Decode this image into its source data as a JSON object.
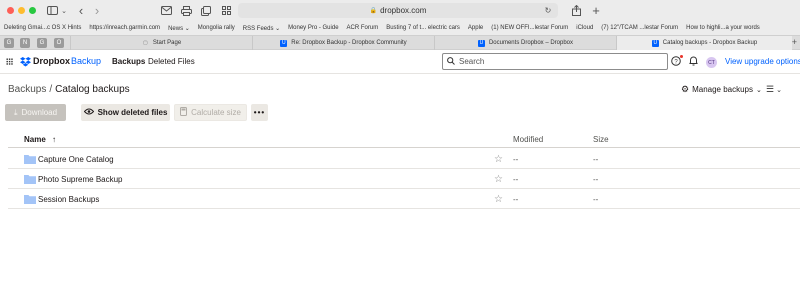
{
  "browser": {
    "url": "dropbox.com",
    "bookmarks": [
      "Deleting Gmai...c OS X Hints",
      "https://inreach.garmin.com",
      "News ⌄",
      "Mongolia rally",
      "RSS Feeds ⌄",
      "Money Pro - Guide",
      "ACR Forum",
      "Busting 7 of t... electric cars",
      "Apple",
      "(1) NEW OFFI...lestar Forum",
      "iCloud",
      "(7) 12\"/TCAM ...lestar Forum",
      "How to highli...a your words"
    ],
    "pinned_tabs": [
      "G",
      "N",
      "G",
      "O"
    ],
    "tabs": [
      {
        "label": "Start Page",
        "icon": "blank-page-icon"
      },
      {
        "label": "Re: Dropbox Backup - Dropbox Community",
        "icon": "dropbox-favicon"
      },
      {
        "label": "Documents Dropbox – Dropbox",
        "icon": "dropbox-favicon"
      },
      {
        "label": "Catalog backups - Dropbox Backup",
        "icon": "dropbox-favicon",
        "active": true
      }
    ]
  },
  "header": {
    "brand_primary": "Dropbox",
    "brand_secondary": "Backup",
    "nav_backups": "Backups",
    "nav_deleted": "Deleted Files",
    "search_placeholder": "Search",
    "avatar_initials": "CT",
    "upgrade_link": "View upgrade options"
  },
  "page": {
    "breadcrumb_parent": "Backups",
    "breadcrumb_sep": "/",
    "breadcrumb_current": "Catalog backups",
    "manage_label": "Manage backups",
    "buttons": {
      "download": "Download",
      "show_deleted": "Show deleted files",
      "calculate": "Calculate size",
      "more": "•••"
    },
    "table": {
      "col_name": "Name",
      "sort_indicator": "↑",
      "col_modified": "Modified",
      "col_size": "Size",
      "rows": [
        {
          "name": "Capture One Catalog",
          "modified": "--",
          "size": "--"
        },
        {
          "name": "Photo Supreme Backup",
          "modified": "--",
          "size": "--"
        },
        {
          "name": "Session Backups",
          "modified": "--",
          "size": "--"
        }
      ]
    }
  },
  "colors": {
    "accent": "#0061fe",
    "folder": "#a3c4f7",
    "button_secondary": "#ebe8e3"
  }
}
